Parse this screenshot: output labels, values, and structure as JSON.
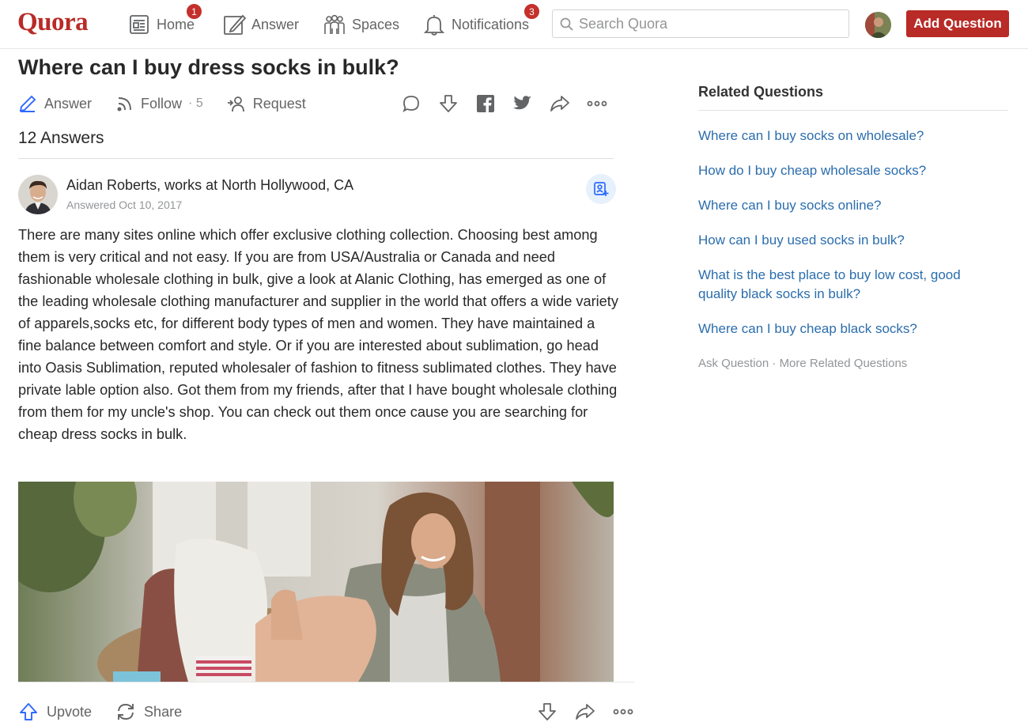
{
  "nav": {
    "logo": "Quora",
    "items": [
      {
        "label": "Home",
        "icon": "home-icon",
        "badge": "1"
      },
      {
        "label": "Answer",
        "icon": "pencil-icon",
        "badge": ""
      },
      {
        "label": "Spaces",
        "icon": "spaces-icon",
        "badge": ""
      },
      {
        "label": "Notifications",
        "icon": "bell-icon",
        "badge": "3"
      }
    ],
    "search_placeholder": "Search Quora",
    "add_question_label": "Add Question"
  },
  "question": {
    "title": "Where can I buy dress socks in bulk?",
    "answer_label": "Answer",
    "follow_label": "Follow",
    "follow_count": "· 5",
    "request_label": "Request",
    "icons": [
      "comment-icon",
      "downvote-icon",
      "facebook-icon",
      "twitter-icon",
      "share-icon",
      "more-icon"
    ],
    "answers_count": "12 Answers"
  },
  "answer": {
    "author": "Aidan Roberts, works at North Hollywood, CA",
    "date": "Answered Oct 10, 2017",
    "body": "There are many sites online which offer exclusive clothing collection. Choosing best among them is very critical and not easy. If you are from USA/Australia or Canada and need fashionable wholesale clothing in bulk, give a look at Alanic Clothing, has emerged as one of the leading wholesale clothing manufacturer and supplier in the world that offers a wide variety of apparels,socks etc, for different body types of men and women. They have maintained a fine balance between comfort and style. Or if you are interested about sublimation, go head into Oasis Sublimation, reputed wholesaler of fashion to fitness sublimated clothes. They have private lable option also. Got them from my friends, after that I have bought wholesale clothing from them for my uncle's shop. You can check out them once cause you are searching for cheap dress socks in bulk.",
    "upvote_label": "Upvote",
    "share_label": "Share"
  },
  "sidebar": {
    "title": "Related Questions",
    "links": [
      "Where can I buy socks on wholesale?",
      "How do I buy cheap wholesale socks?",
      "Where can I buy socks online?",
      "How can I buy used socks in bulk?",
      "What is the best place to buy low cost, good quality black socks in bulk?",
      "Where can I buy cheap black socks?"
    ],
    "ask_question": "Ask Question",
    "separator": " · ",
    "more_related": "More Related Questions"
  },
  "colors": {
    "brand": "#b92b27",
    "link": "#2b6dad",
    "accent_blue": "#2e69ff",
    "muted": "#636466"
  }
}
